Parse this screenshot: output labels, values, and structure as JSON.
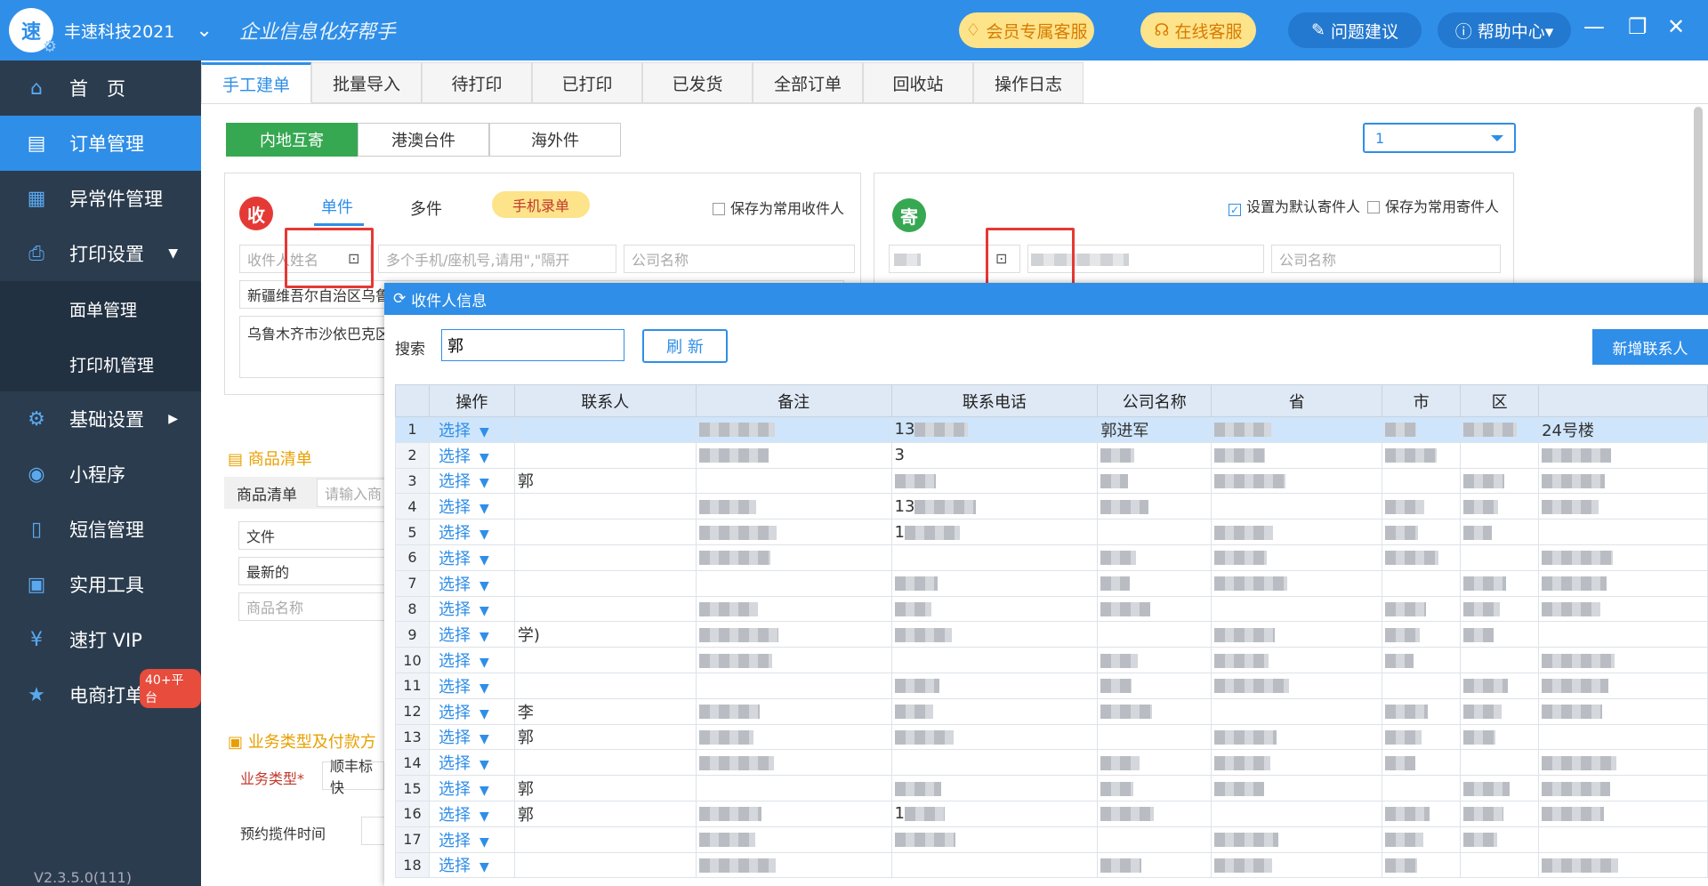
{
  "titlebar": {
    "app_name": "丰速科技2021",
    "slogan": "企业信息化好帮手",
    "vip_service": "会员专属客服",
    "online_service": "在线客服",
    "suggestion": "问题建议",
    "help_center": "帮助中心▾"
  },
  "sidebar": {
    "items": [
      {
        "label": "首　页",
        "icon": "home-icon"
      },
      {
        "label": "订单管理",
        "icon": "order-icon"
      },
      {
        "label": "异常件管理",
        "icon": "exception-icon"
      },
      {
        "label": "打印设置",
        "icon": "printer-icon"
      },
      {
        "label": "面单管理"
      },
      {
        "label": "打印机管理"
      },
      {
        "label": "基础设置",
        "icon": "gear-icon"
      },
      {
        "label": "小程序",
        "icon": "miniapp-icon"
      },
      {
        "label": "短信管理",
        "icon": "sms-icon"
      },
      {
        "label": "实用工具",
        "icon": "toolbox-icon"
      },
      {
        "label": "速打 VIP",
        "icon": "vip-icon"
      },
      {
        "label": "电商打单",
        "icon": "star-icon"
      }
    ],
    "badge": "40+平台",
    "version": "V2.3.5.0(111)"
  },
  "tabs": [
    "手工建单",
    "批量导入",
    "待打印",
    "已打印",
    "已发货",
    "全部订单",
    "回收站",
    "操作日志"
  ],
  "region_tabs": [
    "内地互寄",
    "港澳台件",
    "海外件"
  ],
  "top_select": "1",
  "receiver": {
    "badge": "收",
    "tab_single": "单件",
    "tab_multi": "多件",
    "phone_entry": "手机录单",
    "save_common": "保存为常用收件人",
    "name_placeholder": "收件人姓名",
    "phone_placeholder": "多个手机/座机号,请用\",\"隔开",
    "company_placeholder": "公司名称",
    "region": "新疆维吾尔自治区乌鲁",
    "address": "乌鲁木齐市沙依巴克区"
  },
  "sender": {
    "badge": "寄",
    "default_sender": "设置为默认寄件人",
    "save_common": "保存为常用寄件人",
    "company_placeholder": "公司名称"
  },
  "goods": {
    "section_title": "商品清单",
    "label": "商品清单",
    "placeholder": "请输入商",
    "row1": "文件",
    "row2": "最新的",
    "name_placeholder": "商品名称"
  },
  "business": {
    "section_title": "业务类型及付款方",
    "type_label": "业务类型*",
    "type_value": "顺丰标快",
    "pickup_label": "预约揽件时间"
  },
  "dialog": {
    "title": "收件人信息",
    "search_label": "搜索",
    "search_value": "郭",
    "refresh": "刷 新",
    "new_contact": "新增联系人",
    "columns": [
      "操作",
      "联系人",
      "备注",
      "联系电话",
      "公司名称",
      "省",
      "市",
      "区",
      ""
    ],
    "select_label": "选择",
    "rows": [
      {
        "n": "1",
        "phone": "13",
        "company": "郭进军",
        "extra": "24号楼"
      },
      {
        "n": "2",
        "phone": "3"
      },
      {
        "n": "3",
        "contact": "郭"
      },
      {
        "n": "4",
        "phone": "13"
      },
      {
        "n": "5",
        "phone": "1"
      },
      {
        "n": "6"
      },
      {
        "n": "7"
      },
      {
        "n": "8"
      },
      {
        "n": "9",
        "contact": "学)"
      },
      {
        "n": "10"
      },
      {
        "n": "11"
      },
      {
        "n": "12",
        "contact": "李"
      },
      {
        "n": "13",
        "contact": "郭"
      },
      {
        "n": "14"
      },
      {
        "n": "15",
        "contact": "郭"
      },
      {
        "n": "16",
        "contact": "郭",
        "phone": "1"
      },
      {
        "n": "17"
      },
      {
        "n": "18"
      }
    ]
  }
}
